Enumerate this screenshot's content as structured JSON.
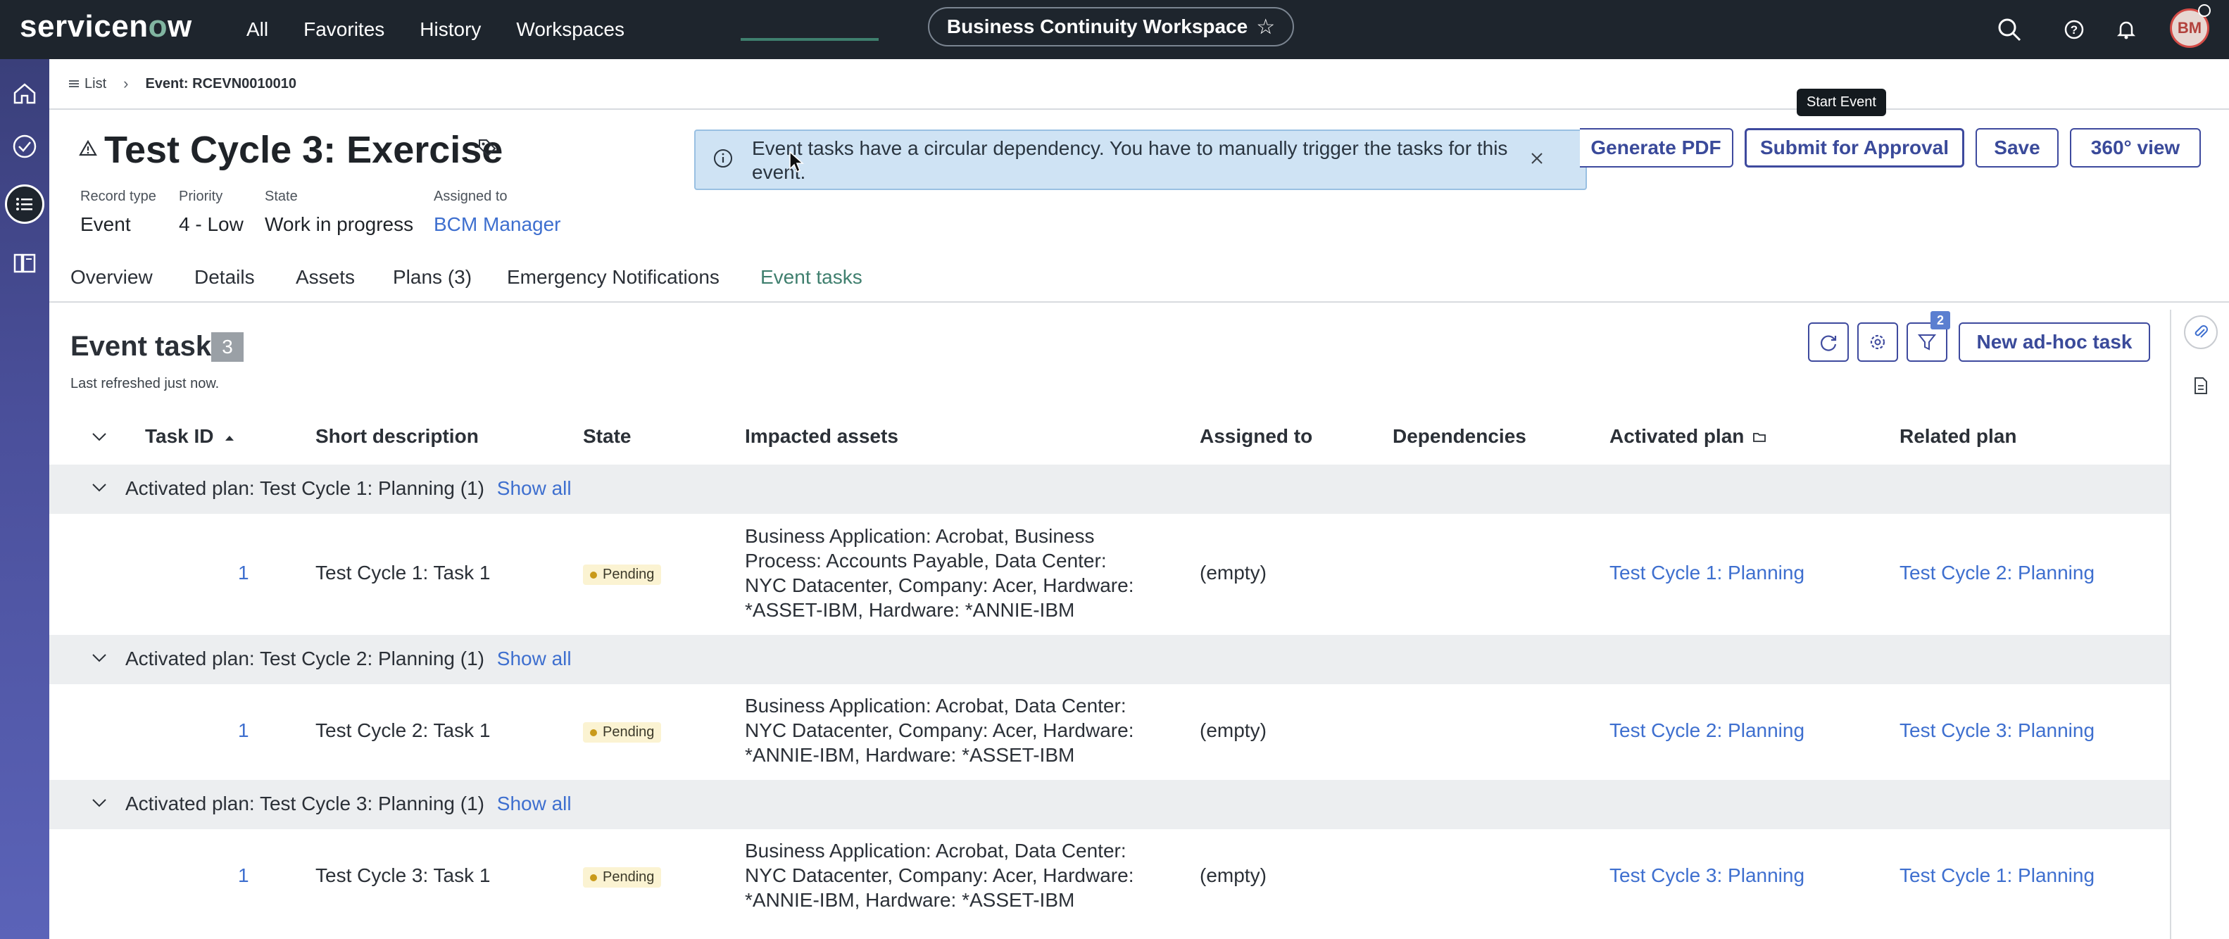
{
  "topbar": {
    "logo": "servicenow",
    "nav": [
      "All",
      "Favorites",
      "History",
      "Workspaces"
    ],
    "workspace": "Business Continuity Workspace",
    "avatar_initials": "BM"
  },
  "breadcrumb": {
    "list": "List",
    "current": "Event: RCEVN0010010"
  },
  "record": {
    "title": "Test Cycle 3: Exercise",
    "meta": [
      {
        "label": "Record type",
        "value": "Event"
      },
      {
        "label": "Priority",
        "value": "4 - Low"
      },
      {
        "label": "State",
        "value": "Work in progress"
      },
      {
        "label": "Assigned to",
        "value": "BCM Manager"
      }
    ]
  },
  "notice": {
    "text": "Event tasks have a circular dependency. You have to manually trigger the tasks for this event."
  },
  "tooltip": "Start Event",
  "actions": {
    "generate_pdf": "Generate PDF",
    "submit": "Submit for Approval",
    "save": "Save",
    "view360": "360° view"
  },
  "tabs": [
    "Overview",
    "Details",
    "Assets",
    "Plans (3)",
    "Emergency Notifications",
    "Event tasks"
  ],
  "active_tab": "Event tasks",
  "panel": {
    "title": "Event task",
    "count": "3",
    "refreshed": "Last refreshed just now.",
    "filter_count": "2",
    "new_task": "New ad-hoc task"
  },
  "table": {
    "columns": [
      "Task ID",
      "Short description",
      "State",
      "Impacted assets",
      "Assigned to",
      "Dependencies",
      "Activated plan",
      "Related plan"
    ],
    "show_all": "Show all",
    "groups": [
      {
        "label": "Activated plan: Test Cycle 1: Planning (1)",
        "row": {
          "id": "1",
          "desc": "Test Cycle 1: Task 1",
          "state": "Pending",
          "assets": "Business Application: Acrobat, Business Process: Accounts Payable, Data Center: NYC Datacenter, Company: Acer, Hardware: *ASSET-IBM, Hardware: *ANNIE-IBM",
          "assigned": "(empty)",
          "activated": "Test Cycle 1: Planning",
          "related": "Test Cycle 2: Planning"
        }
      },
      {
        "label": "Activated plan: Test Cycle 2: Planning (1)",
        "row": {
          "id": "1",
          "desc": "Test Cycle 2: Task 1",
          "state": "Pending",
          "assets": "Business Application: Acrobat, Data Center: NYC Datacenter, Company: Acer, Hardware: *ANNIE-IBM, Hardware: *ASSET-IBM",
          "assigned": "(empty)",
          "activated": "Test Cycle 2: Planning",
          "related": "Test Cycle 3: Planning"
        }
      },
      {
        "label": "Activated plan: Test Cycle 3: Planning (1)",
        "row": {
          "id": "1",
          "desc": "Test Cycle 3: Task 1",
          "state": "Pending",
          "assets": "Business Application: Acrobat, Data Center: NYC Datacenter, Company: Acer, Hardware: *ANNIE-IBM, Hardware: *ASSET-IBM",
          "assigned": "(empty)",
          "activated": "Test Cycle 3: Planning",
          "related": "Test Cycle 1: Planning"
        }
      }
    ]
  },
  "colors": {
    "topbar": "#1e252d",
    "accent": "#3e4a9e",
    "link": "#3e6fcf",
    "active_tab": "#3f7f6e"
  }
}
